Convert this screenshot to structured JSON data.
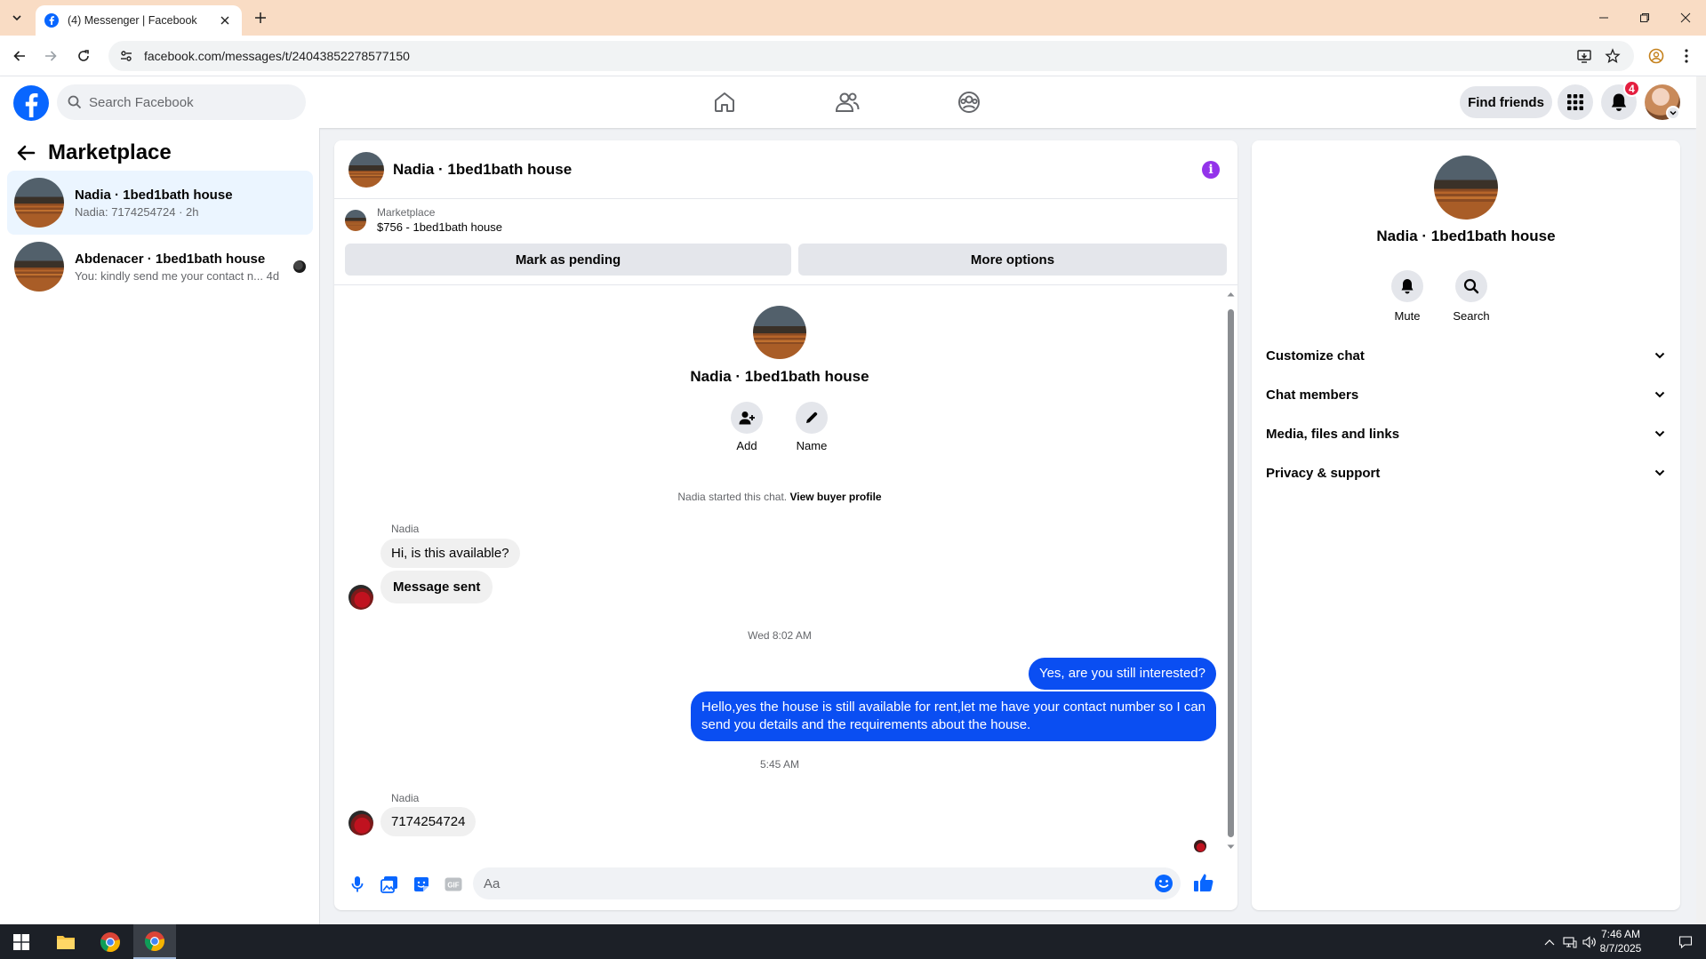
{
  "browser": {
    "tab_title": "(4) Messenger | Facebook",
    "url": "facebook.com/messages/t/24043852278577150"
  },
  "header": {
    "search_placeholder": "Search Facebook",
    "find_friends_label": "Find friends",
    "notification_count": "4"
  },
  "sidebar": {
    "title": "Marketplace",
    "conversations": [
      {
        "name": "Nadia · 1bed1bath house",
        "preview": "Nadia: 7174254724 · 2h",
        "active": true
      },
      {
        "name": "Abdenacer · 1bed1bath house",
        "preview": "You: kindly send me your contact n...",
        "time": "4d"
      }
    ]
  },
  "chat": {
    "title": "Nadia · 1bed1bath house",
    "listing": {
      "label": "Marketplace",
      "value": "$756 - 1bed1bath house"
    },
    "mark_pending_label": "Mark as pending",
    "more_options_label": "More options",
    "intro_name": "Nadia · 1bed1bath house",
    "add_label": "Add",
    "name_label": "Name",
    "started_text": "Nadia started this chat.",
    "view_profile_link": "View buyer profile",
    "messages": [
      {
        "sender": "Nadia",
        "text": "Hi, is this available?"
      },
      {
        "text": "Message sent"
      },
      {
        "timestamp": "Wed 8:02 AM"
      },
      {
        "text": "Yes, are you still interested?"
      },
      {
        "text_line1": "Hello,yes the house is still available for rent,let me have your contact number so I can",
        "text_line2": "send you details and the requirements about the house."
      },
      {
        "timestamp": "5:45 AM"
      },
      {
        "sender": "Nadia",
        "text": "7174254724"
      }
    ],
    "composer_placeholder": "Aa"
  },
  "details": {
    "name": "Nadia · 1bed1bath house",
    "mute_label": "Mute",
    "search_label": "Search",
    "sections": [
      "Customize chat",
      "Chat members",
      "Media, files and links",
      "Privacy & support"
    ]
  },
  "taskbar": {
    "time": "7:46 AM",
    "date": "8/7/2025"
  },
  "colors": {
    "fb_blue": "#0866ff",
    "outgoing_bubble": "#0a4ef2",
    "info_purple": "#9333ea",
    "badge_red": "#e41e3f",
    "tabbar": "#f9dcc4"
  }
}
